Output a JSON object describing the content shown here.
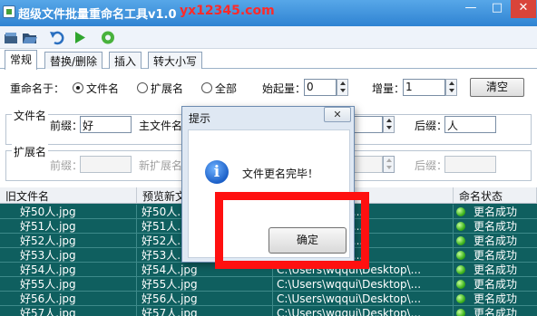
{
  "window": {
    "title": "超级文件批量重命名工具v1.0",
    "watermark": "yx12345.com",
    "min_label": "—",
    "max_label": "□",
    "close_label": "✕"
  },
  "toolbar": {
    "icons": [
      "new-icon",
      "open-icon",
      "undo-icon",
      "run-icon",
      "recycle-icon"
    ]
  },
  "tabs": [
    {
      "label": "常规",
      "active": true
    },
    {
      "label": "替换/删除",
      "active": false
    },
    {
      "label": "插入",
      "active": false
    },
    {
      "label": "转大小写",
      "active": false
    }
  ],
  "rename": {
    "label": "重命名于：",
    "options": [
      {
        "label": "文件名",
        "selected": true
      },
      {
        "label": "扩展名",
        "selected": false
      },
      {
        "label": "全部",
        "selected": false
      }
    ],
    "start_label": "始起量：",
    "start_value": "0",
    "step_label": "增量：",
    "step_value": "1",
    "clear_label": "清空"
  },
  "filename_group": {
    "title": "文件名",
    "prefix_label": "前缀：",
    "prefix_value": "好",
    "main_label": "主文件名",
    "suffix_label": "后缀：",
    "suffix_value": "人"
  },
  "ext_group": {
    "title": "扩展名",
    "prefix_label": "前缀：",
    "main_label": "新扩展名",
    "suffix_label": "后缀："
  },
  "table": {
    "headers": [
      "旧文件名",
      "预览新文",
      "",
      "命名状态"
    ],
    "rows": [
      {
        "old": "好50人.jpg",
        "preview": "好50人.",
        "path": "qqui\\Desktop\\...",
        "status": "更名成功"
      },
      {
        "old": "好51人.jpg",
        "preview": "好51人.",
        "path": "qqui\\Desktop\\...",
        "status": "更名成功"
      },
      {
        "old": "好52人.jpg",
        "preview": "好52人.",
        "path": "qqui\\Desktop\\...",
        "status": "更名成功"
      },
      {
        "old": "好53人.jpg",
        "preview": "好53人.",
        "path": "qqui\\Desktop\\...",
        "status": "更名成功"
      },
      {
        "old": "好54人.jpg",
        "preview": "好54人.jpg",
        "path": "C:\\Users\\wqqui\\Desktop\\...",
        "status": "更名成功"
      },
      {
        "old": "好55人.jpg",
        "preview": "好55人.jpg",
        "path": "C:\\Users\\wqqui\\Desktop\\...",
        "status": "更名成功"
      },
      {
        "old": "好56人.jpg",
        "preview": "好56人.jpg",
        "path": "C:\\Users\\wqqui\\Desktop\\...",
        "status": "更名成功"
      },
      {
        "old": "好57人.jpg",
        "preview": "好57人.jpg",
        "path": "C:\\Users\\wqqui\\Desktop\\...",
        "status": "更名成功"
      }
    ]
  },
  "dialog": {
    "title": "提示",
    "close_label": "✕",
    "message": "文件更名完毕！",
    "ok_label": "确定",
    "info_glyph": "i"
  },
  "colors": {
    "list_bg": "#0f5f5f",
    "highlight": "#ff1010",
    "watermark": "#ff2a2a"
  }
}
